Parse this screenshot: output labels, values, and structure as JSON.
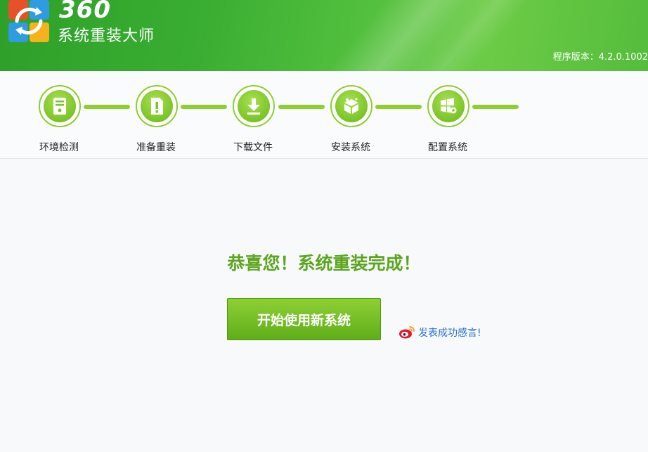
{
  "header": {
    "logo_number": "360",
    "logo_name": "系统重装大师",
    "version": "程序版本：4.2.0.1002"
  },
  "steps": [
    {
      "label": "环境检测",
      "icon": "monitor-icon"
    },
    {
      "label": "准备重装",
      "icon": "document-alert-icon"
    },
    {
      "label": "下载文件",
      "icon": "download-icon"
    },
    {
      "label": "安装系统",
      "icon": "install-box-icon"
    },
    {
      "label": "配置系统",
      "icon": "windows-gear-icon"
    }
  ],
  "main": {
    "title": "恭喜您！系统重装完成！",
    "start_button": "开始使用新系统",
    "share_link": "发表成功感言!"
  },
  "colors": {
    "header_green": "#3fae32",
    "step_green": "#8ccf2e",
    "title_green": "#5ba51f",
    "link_blue": "#2c72c8"
  }
}
